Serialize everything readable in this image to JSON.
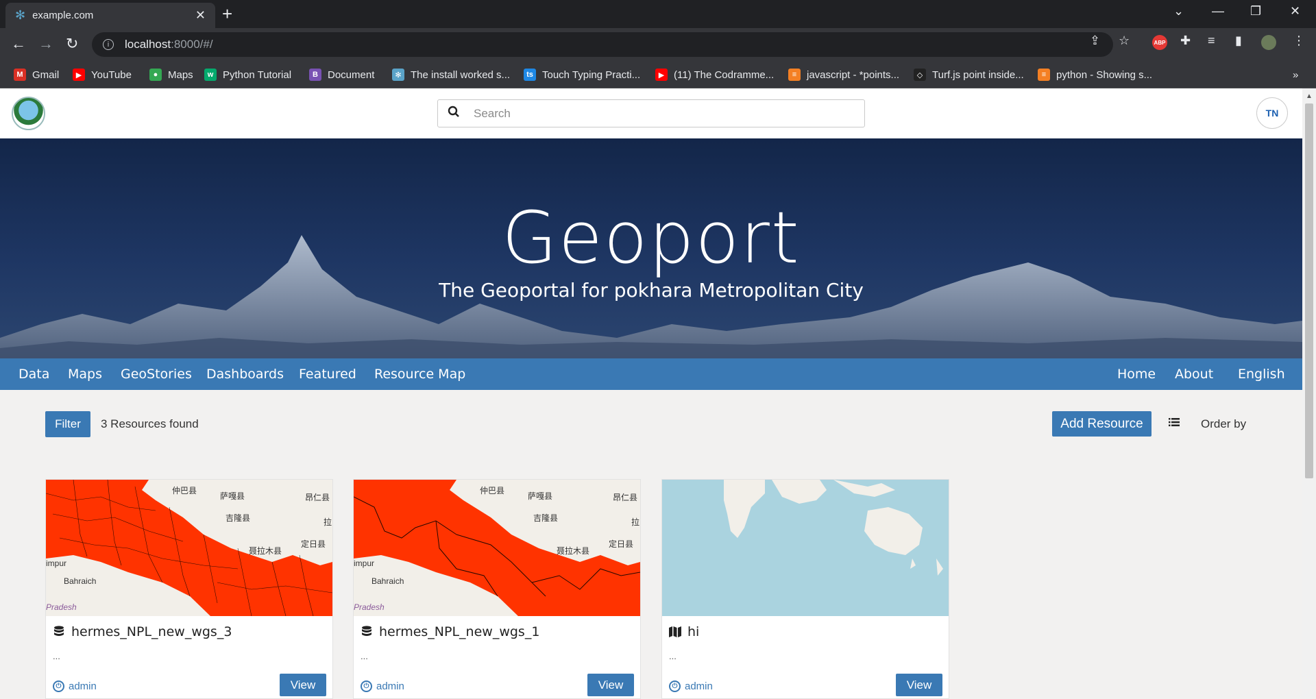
{
  "browser": {
    "tab_title": "example.com",
    "tab_close": "✕",
    "new_tab": "+",
    "url_host": "localhost",
    "url_rest": ":8000/#/",
    "bookmarks": [
      {
        "label": "Gmail",
        "icon": "gmail-icon",
        "color": "#d93025",
        "glyph": "M"
      },
      {
        "label": "YouTube",
        "icon": "youtube-icon",
        "color": "#ff0000",
        "glyph": "▶"
      },
      {
        "label": "Maps",
        "icon": "maps-icon",
        "color": "#34a853",
        "glyph": "●"
      },
      {
        "label": "Python Tutorial",
        "icon": "w3schools-icon",
        "color": "#04aa6d",
        "glyph": "w"
      },
      {
        "label": "Document",
        "icon": "bootstrap-icon",
        "color": "#7952b3",
        "glyph": "B"
      },
      {
        "label": "The install worked s...",
        "icon": "django-icon",
        "color": "#5aa3c8",
        "glyph": "✻"
      },
      {
        "label": "Touch Typing Practi...",
        "icon": "typingclub-icon",
        "color": "#1e88e5",
        "glyph": "ts"
      },
      {
        "label": "(11) The Codramme...",
        "icon": "youtube-icon",
        "color": "#ff0000",
        "glyph": "▶"
      },
      {
        "label": "javascript - *points...",
        "icon": "stackoverflow-icon",
        "color": "#f48024",
        "glyph": "≡"
      },
      {
        "label": "Turf.js point inside...",
        "icon": "codepen-icon",
        "color": "#222222",
        "glyph": "◇"
      },
      {
        "label": "python - Showing s...",
        "icon": "stackoverflow-icon",
        "color": "#f48024",
        "glyph": "≡"
      }
    ],
    "more_bookmarks": "»"
  },
  "header": {
    "search_placeholder": "Search"
  },
  "hero": {
    "title": "Geoport",
    "subtitle": "The Geoportal for pokhara Metropolitan City"
  },
  "menu": {
    "left": [
      "Data",
      "Maps",
      "GeoStories",
      "Dashboards",
      "Featured",
      "Resource Map"
    ],
    "right": [
      "Home",
      "About",
      "English"
    ]
  },
  "toolbar": {
    "filter_label": "Filter",
    "count_text": "3 Resources found",
    "add_label": "Add Resource",
    "order_label": "Order by"
  },
  "cards": [
    {
      "title": "hermes_NPL_new_wgs_3",
      "type_icon": "database-icon",
      "abstract": "...",
      "owner": "admin",
      "view_label": "View"
    },
    {
      "title": "hermes_NPL_new_wgs_1",
      "type_icon": "database-icon",
      "abstract": "...",
      "owner": "admin",
      "view_label": "View"
    },
    {
      "title": "hi",
      "type_icon": "map-icon",
      "abstract": "...",
      "owner": "admin",
      "view_label": "View"
    }
  ],
  "map_labels": [
    "仲巴县",
    "萨嘎县",
    "昂仁县",
    "吉隆县",
    "拉",
    "定日县",
    "聂拉木县",
    "impur",
    "Bahraich",
    "Pradesh"
  ],
  "colors": {
    "primary": "#3a79b4",
    "layer_fill": "#ff3300",
    "ocean": "#aad3df"
  }
}
